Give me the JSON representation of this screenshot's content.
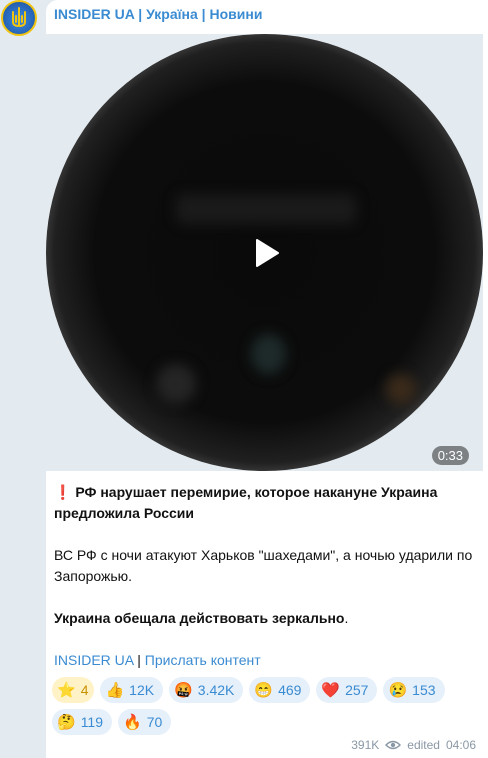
{
  "channel": {
    "title_part1": "INSIDER UA",
    "separator": " | ",
    "title_part2": "Україна",
    "title_part3": "Новини"
  },
  "video": {
    "duration": "0:33"
  },
  "post": {
    "alert_emoji": "❗",
    "headline": "РФ нарушает перемирие, которое накануне Украина предложила России",
    "body": "ВС РФ с ночи атакуют Харьков \"шахедами\", а ночью ударили по Запорожью.",
    "closing": "Украина обещала действовать зеркально",
    "closing_end": "."
  },
  "links": {
    "link1": "INSIDER UA",
    "bar": " | ",
    "link2": "Прислать контент"
  },
  "reactions": [
    {
      "emoji": "⭐",
      "count": "4",
      "kind": "star"
    },
    {
      "emoji": "👍",
      "count": "12K"
    },
    {
      "emoji": "🤬",
      "count": "3.42K"
    },
    {
      "emoji": "😁",
      "count": "469"
    },
    {
      "emoji": "❤️",
      "count": "257"
    },
    {
      "emoji": "😢",
      "count": "153"
    },
    {
      "emoji": "🤔",
      "count": "119"
    },
    {
      "emoji": "🔥",
      "count": "70"
    }
  ],
  "meta": {
    "views": "391K",
    "edited_label": "edited",
    "time": "04:06"
  },
  "colors": {
    "accent": "#3a8bd1",
    "background": "#e4ebf0",
    "reaction_bg": "#e6f0fa"
  }
}
